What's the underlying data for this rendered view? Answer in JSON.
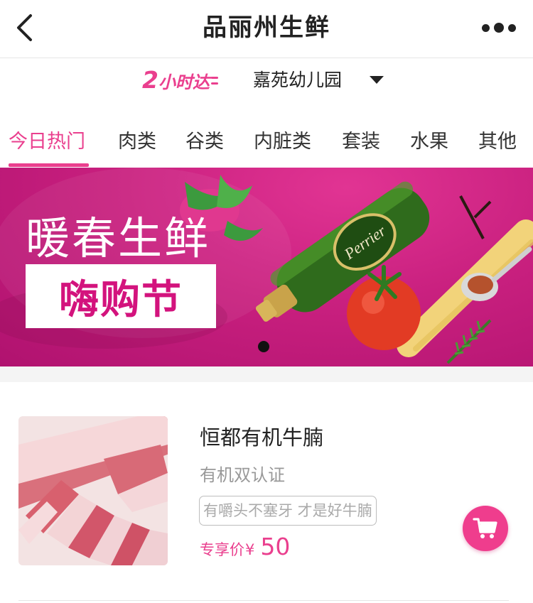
{
  "header": {
    "title": "品丽州生鲜",
    "back_icon": "chevron-left-icon",
    "more_icon": "more-dots-icon"
  },
  "delivery": {
    "badge_number": "2",
    "badge_text": "小时达",
    "location": "嘉苑幼儿园",
    "dropdown_icon": "caret-down-icon"
  },
  "tabs": [
    {
      "label": "今日热门",
      "active": true
    },
    {
      "label": "肉类",
      "active": false
    },
    {
      "label": "谷类",
      "active": false
    },
    {
      "label": "内脏类",
      "active": false
    },
    {
      "label": "套装",
      "active": false
    },
    {
      "label": "水果",
      "active": false
    },
    {
      "label": "其他",
      "active": false
    }
  ],
  "banner": {
    "headline": "暖春生鲜",
    "highlight": "嗨购节",
    "bottle_label": "Perrier",
    "current_slide": 1
  },
  "products": [
    {
      "name": "恒都有机牛腩",
      "certification": "有机双认证",
      "tagline": "有嚼头不塞牙 才是好牛腩",
      "price_label": "专享价",
      "currency": "¥",
      "price": "50",
      "cart_icon": "cart-icon"
    }
  ],
  "colors": {
    "accent": "#ea3f8e",
    "banner": "#c9207f",
    "text": "#222222",
    "muted": "#999999"
  }
}
